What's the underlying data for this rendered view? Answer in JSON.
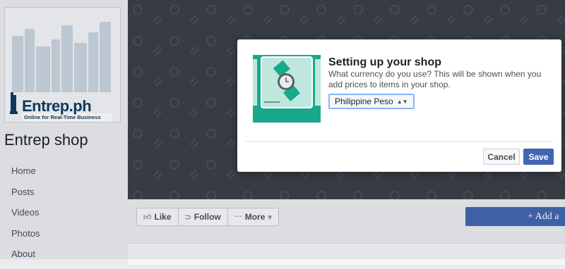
{
  "page": {
    "name": "Entrep shop",
    "logo_text": "Entrep.ph",
    "logo_tagline": "Online for Real-Time Business"
  },
  "sidebar": {
    "items": [
      {
        "label": "Home"
      },
      {
        "label": "Posts"
      },
      {
        "label": "Videos"
      },
      {
        "label": "Photos"
      },
      {
        "label": "About"
      }
    ]
  },
  "actions": {
    "like": "Like",
    "follow": "Follow",
    "more": "More",
    "add": "+ Add a"
  },
  "dialog": {
    "title": "Setting up your shop",
    "description": "What currency do you use? This will be shown when you add prices to items in your shop.",
    "currency_value": "Philippine Peso",
    "cancel": "Cancel",
    "save": "Save"
  },
  "colors": {
    "brand_blue": "#4267b2",
    "illustration_teal": "#17a98a",
    "cover_dark": "#3b4049"
  },
  "icons": [
    "like-icon",
    "follow-icon",
    "more-icon",
    "chevron-down-icon",
    "watch-icon"
  ]
}
